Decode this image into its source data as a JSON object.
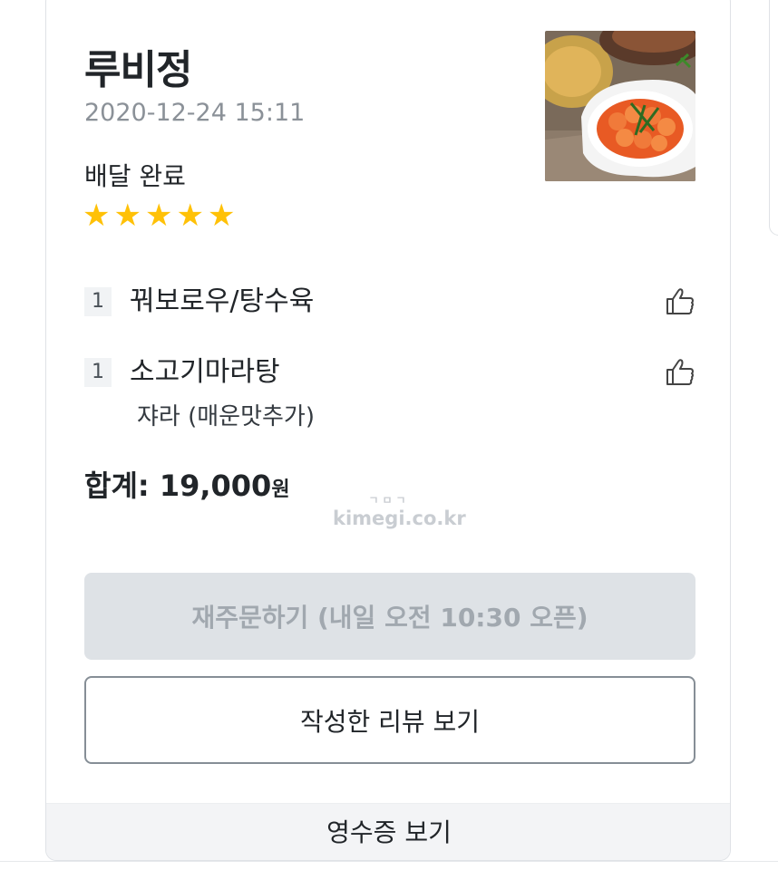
{
  "order": {
    "store_name": "루비정",
    "datetime": "2020-12-24 15:11",
    "status": "배달 완료",
    "rating": 5,
    "rating_icon": "star-icon",
    "rating_color": "#ffc107",
    "thumbnail": "food-photo"
  },
  "items": [
    {
      "qty": "1",
      "name": "꿔보로우/탕수육",
      "like_icon": "thumbs-up-icon"
    },
    {
      "qty": "1",
      "name": "소고기마라탕",
      "option": "쟈라 (매운맛추가)",
      "like_icon": "thumbs-up-icon"
    }
  ],
  "total": {
    "label": "합계: ",
    "amount": "19,000",
    "unit": "원"
  },
  "watermark": {
    "line1": "ㄱㅁㄱ",
    "line2": "kimegi.co.kr"
  },
  "buttons": {
    "reorder": "재주문하기 (내일 오전 10:30 오픈)",
    "view_review": "작성한 리뷰 보기",
    "view_receipt": "영수증 보기"
  },
  "colors": {
    "star": "#ffc107",
    "disabled_button_bg": "#dee2e6",
    "disabled_button_text": "#a1a8af",
    "muted_text": "#8b9198"
  }
}
